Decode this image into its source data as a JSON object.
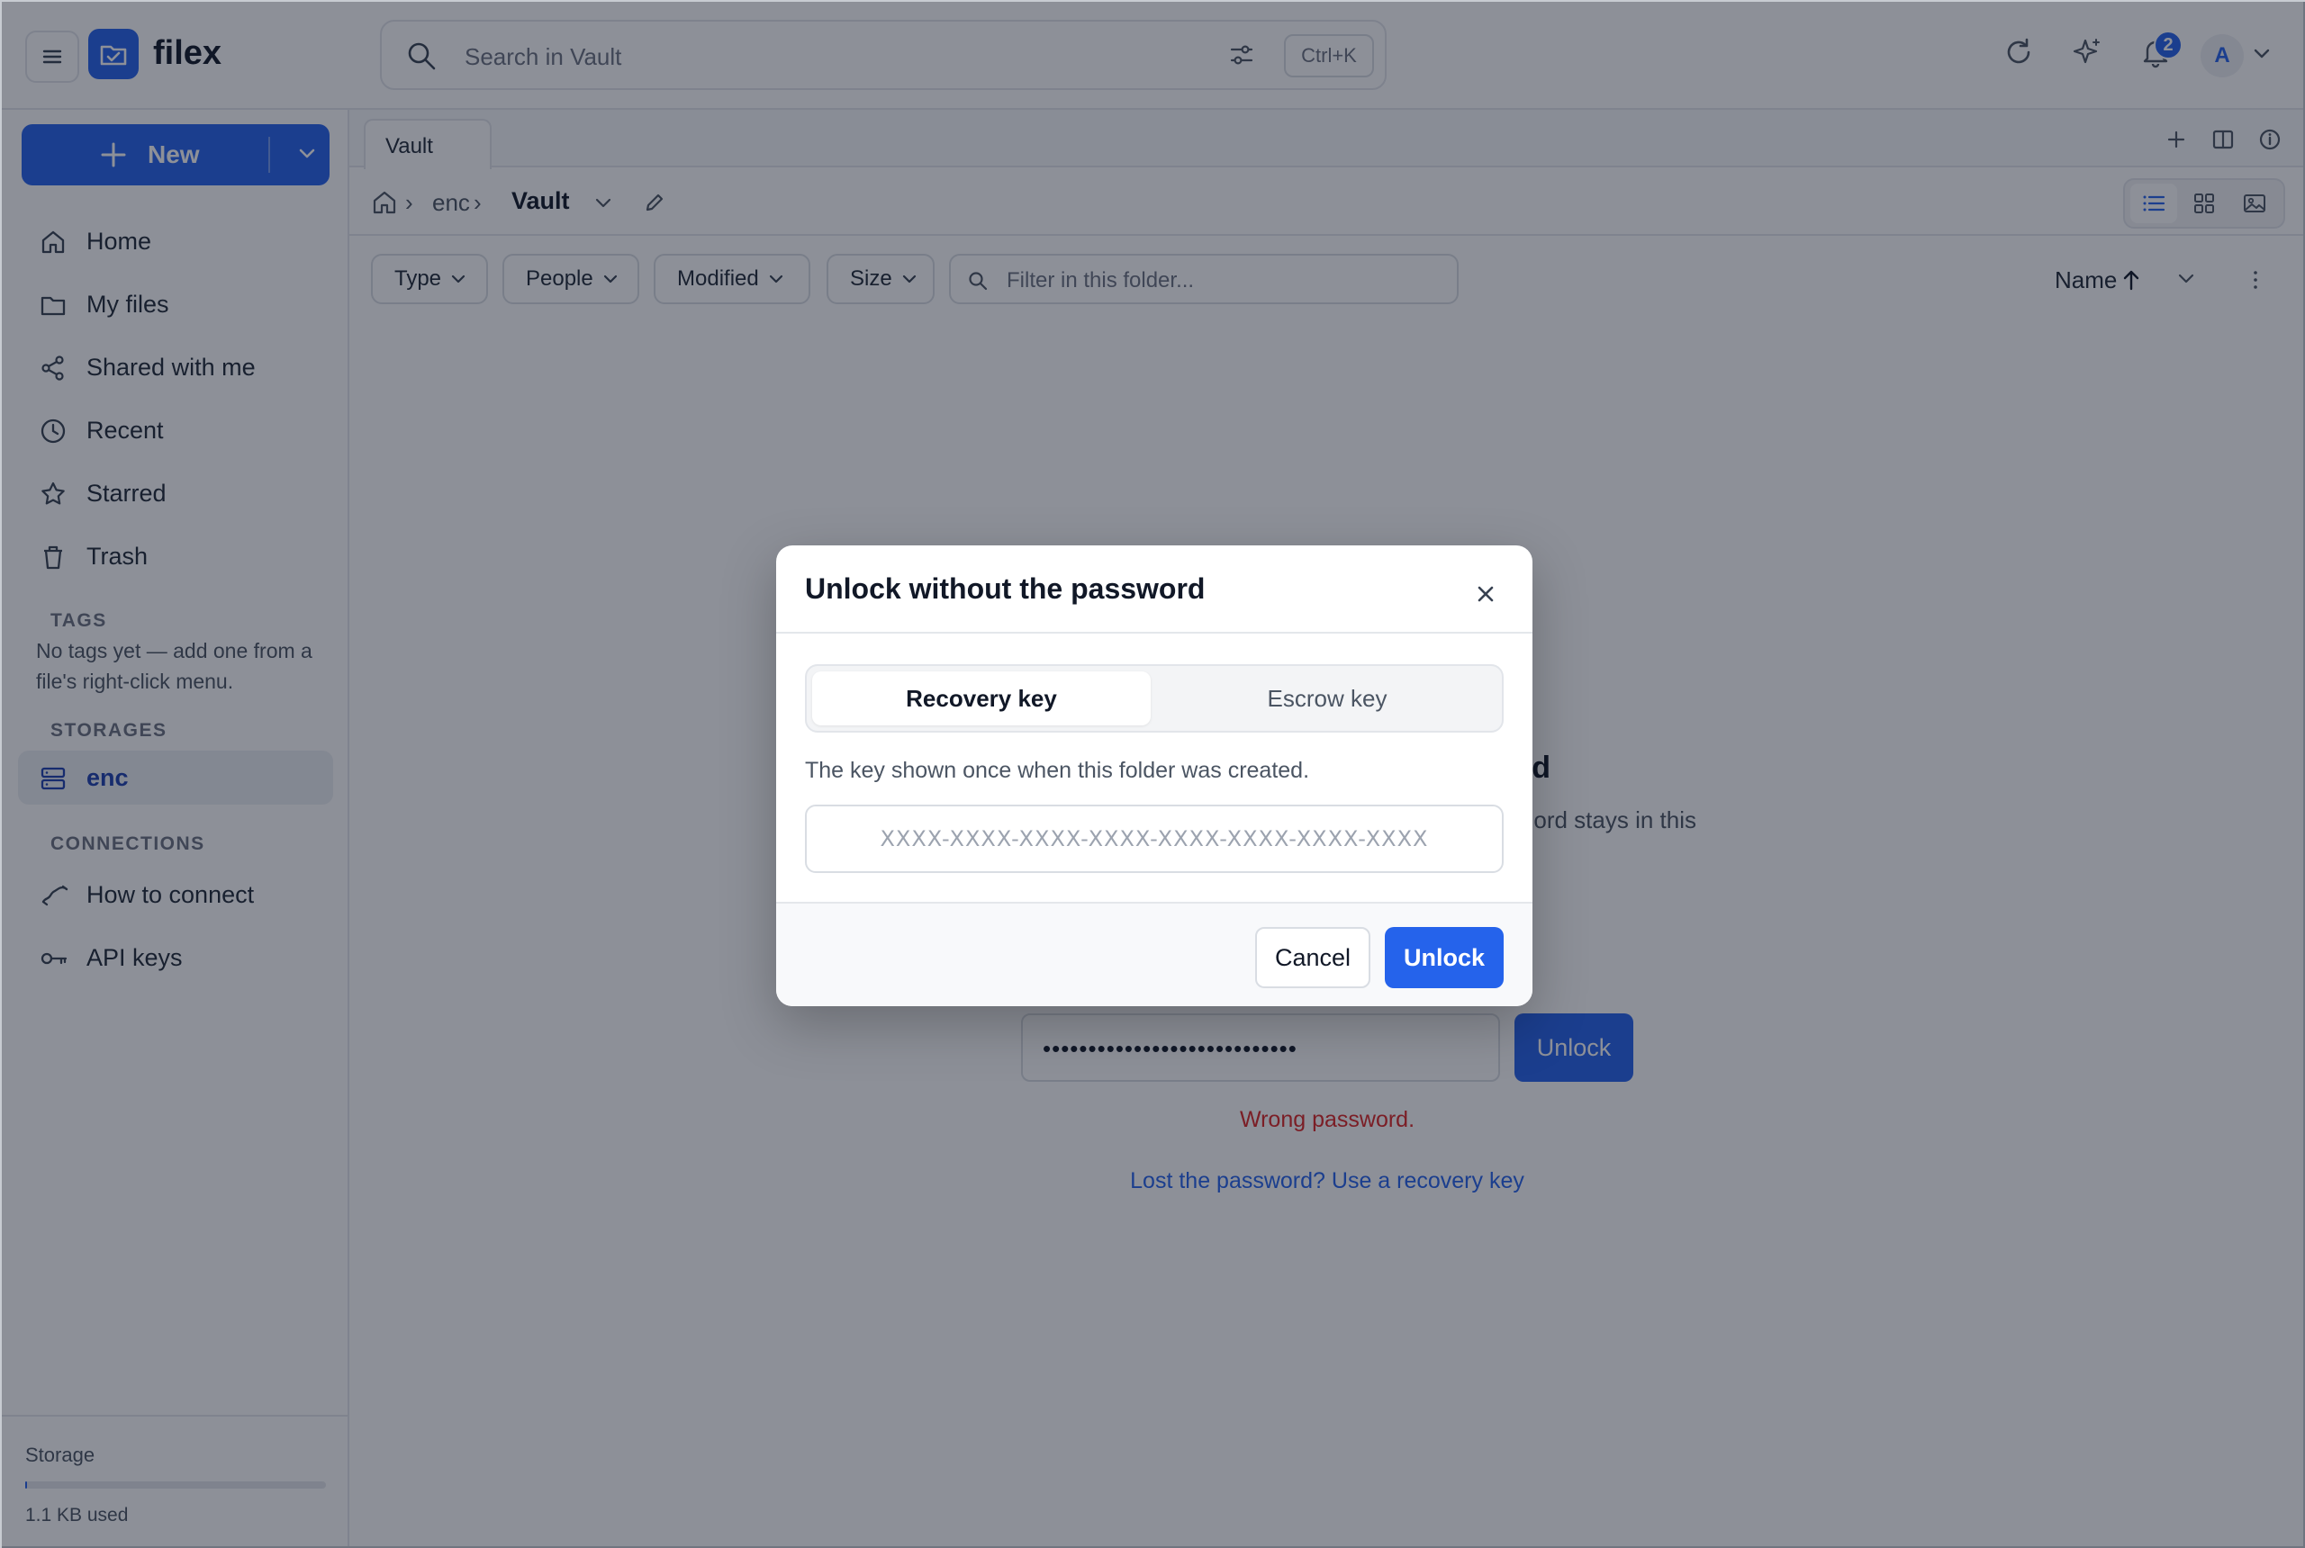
{
  "app": {
    "name": "filex",
    "brand_color": "#2563eb"
  },
  "topbar": {
    "search_placeholder": "Search in Vault",
    "shortcut": "Ctrl+K",
    "notification_count": "2",
    "avatar_initial": "A",
    "icons": [
      "menu-icon",
      "search-icon",
      "sliders-icon",
      "refresh-icon",
      "sparkle-icon",
      "bell-icon",
      "chevron-down-icon"
    ]
  },
  "sidebar": {
    "new_label": "New",
    "nav": [
      {
        "label": "Home",
        "icon": "home-icon"
      },
      {
        "label": "My files",
        "icon": "folder-icon"
      },
      {
        "label": "Shared with me",
        "icon": "share-icon"
      },
      {
        "label": "Recent",
        "icon": "clock-icon"
      },
      {
        "label": "Starred",
        "icon": "star-icon"
      },
      {
        "label": "Trash",
        "icon": "trash-icon"
      }
    ],
    "tags_title": "TAGS",
    "tags_empty": "No tags yet — add one from a file's right-click menu.",
    "storages_title": "STORAGES",
    "storages": [
      {
        "label": "enc",
        "icon": "storage-icon",
        "active": true
      }
    ],
    "connections_title": "CONNECTIONS",
    "connections": [
      {
        "label": "How to connect",
        "icon": "link-icon"
      },
      {
        "label": "API keys",
        "icon": "key-icon"
      }
    ],
    "storage": {
      "label": "Storage",
      "used": "1.1 KB used",
      "used_fraction": 0.001
    }
  },
  "main": {
    "tab_label": "Vault",
    "breadcrumb": {
      "root": "enc",
      "current": "Vault"
    },
    "filters": {
      "type": "Type",
      "people": "People",
      "modified": "Modified",
      "size": "Size",
      "filter_placeholder": "Filter in this folder..."
    },
    "sort_label": "Name",
    "locked": {
      "title_visible": "d",
      "desc_visible": "ord stays in this",
      "password_masked": "••••••••••••••••••••••••••••",
      "unlock_label": "Unlock",
      "error": "Wrong password.",
      "recovery_link": "Lost the password? Use a recovery key"
    }
  },
  "modal": {
    "title": "Unlock without the password",
    "tabs": [
      "Recovery key",
      "Escrow key"
    ],
    "active_tab": 0,
    "description": "The key shown once when this folder was created.",
    "key_placeholder": "XXXX-XXXX-XXXX-XXXX-XXXX-XXXX-XXXX-XXXX",
    "cancel_label": "Cancel",
    "unlock_label": "Unlock"
  }
}
